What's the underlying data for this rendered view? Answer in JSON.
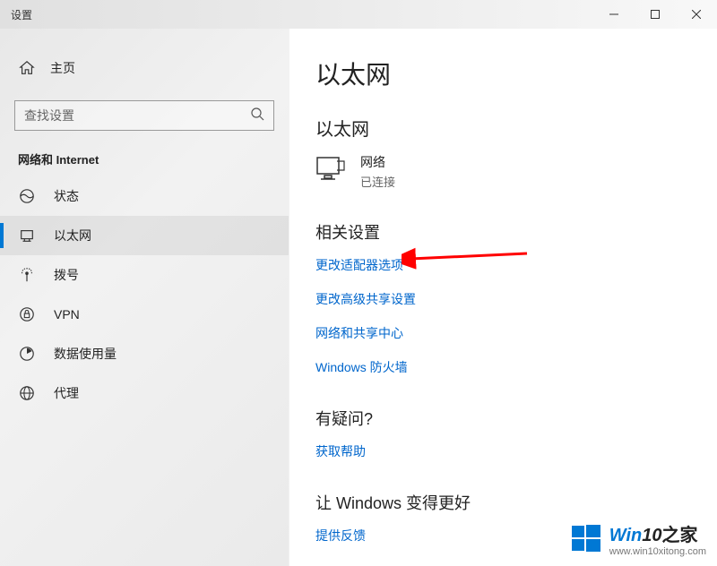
{
  "titlebar": {
    "title": "设置"
  },
  "sidebar": {
    "home": "主页",
    "search_placeholder": "查找设置",
    "category": "网络和 Internet",
    "items": [
      {
        "label": "状态",
        "icon": "status"
      },
      {
        "label": "以太网",
        "icon": "ethernet"
      },
      {
        "label": "拨号",
        "icon": "dialup"
      },
      {
        "label": "VPN",
        "icon": "vpn"
      },
      {
        "label": "数据使用量",
        "icon": "data"
      },
      {
        "label": "代理",
        "icon": "proxy"
      }
    ],
    "active_index": 1
  },
  "main": {
    "title": "以太网",
    "connection_section": "以太网",
    "connection": {
      "name": "网络",
      "status": "已连接"
    },
    "related_section": "相关设置",
    "links": [
      "更改适配器选项",
      "更改高级共享设置",
      "网络和共享中心",
      "Windows 防火墙"
    ],
    "help_section": "有疑问?",
    "help_link": "获取帮助",
    "feedback_section": "让 Windows 变得更好",
    "feedback_link": "提供反馈"
  },
  "watermark": {
    "brand_a": "Win",
    "brand_b": "10",
    "brand_c": "之家",
    "url": "www.win10xitong.com"
  }
}
